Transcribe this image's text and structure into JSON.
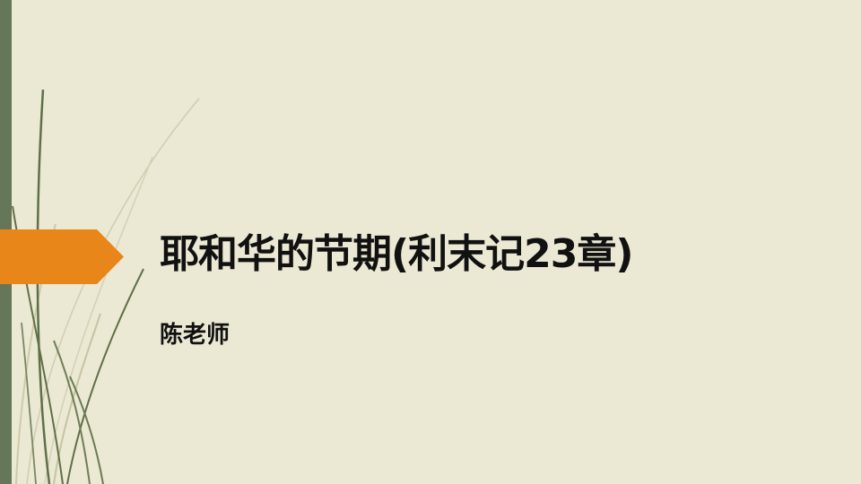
{
  "slide": {
    "title": "耶和华的节期(利末记23章)",
    "presenter": "陈老师"
  },
  "colors": {
    "background": "#ebe8d3",
    "left_bar": "#667658",
    "accent_arrow": "#e8861a",
    "grass_dark": "#5f7048",
    "grass_light": "#c9c8a6"
  }
}
